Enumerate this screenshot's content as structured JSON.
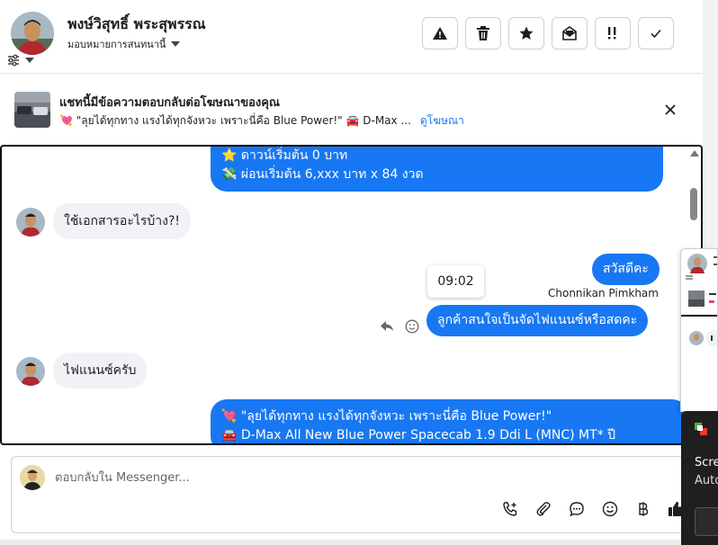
{
  "header": {
    "name": "พงษ์วิสุทธิ์ พระสุพรรณ",
    "assign_label": "มอบหมายการสนทนานี้",
    "actions": [
      "spam-icon",
      "trash-icon",
      "star-icon",
      "mark-unread-icon",
      "follow-up-icon",
      "done-icon"
    ]
  },
  "ad": {
    "title": "แชทนี้มีข้อความตอบกลับต่อโฆษณาของคุณ",
    "text": "💘 \"ลุยได้ทุกทาง แรงได้ทุกจังหวะ เพราะนี่คือ Blue Power!\" 🚘 D-Max ...",
    "link": "ดูโฆษณา"
  },
  "messages": {
    "top_out_line1": "⭐ ดาวน์เริ่มต้น 0 บาท",
    "top_out_line2": "💸 ผ่อนเริ่มต้น 6,xxx บาท x 84 งวด",
    "in_1": "ใช้เอกสารอะไรบ้าง?!",
    "out_greet": "สวัสดีคะ",
    "time": "09:02",
    "sender": "Chonnikan Pimkham",
    "out_ask": "ลูกค้าสนใจเป็นจัดไฟแนนซ์หรือสดคะ",
    "in_2": "ไฟแนนซ์ครับ",
    "bottom_out_line1": "💘 \"ลุยได้ทุกทาง แรงได้ทุกจังหวะ  เพราะนี่คือ Blue Power!\"",
    "bottom_out_line2": "🚘 D-Max All New Blue Power Spacecab 1.9 Ddi L (MNC) MT* ปี"
  },
  "composer": {
    "placeholder": "ตอบกลับใน Messenger..."
  },
  "side_panel": {
    "line1": "Scre",
    "line2": "Auto"
  },
  "colors": {
    "accent": "#1877f2",
    "incoming_bubble": "#f0f2f5",
    "border": "#ccd0d5"
  }
}
